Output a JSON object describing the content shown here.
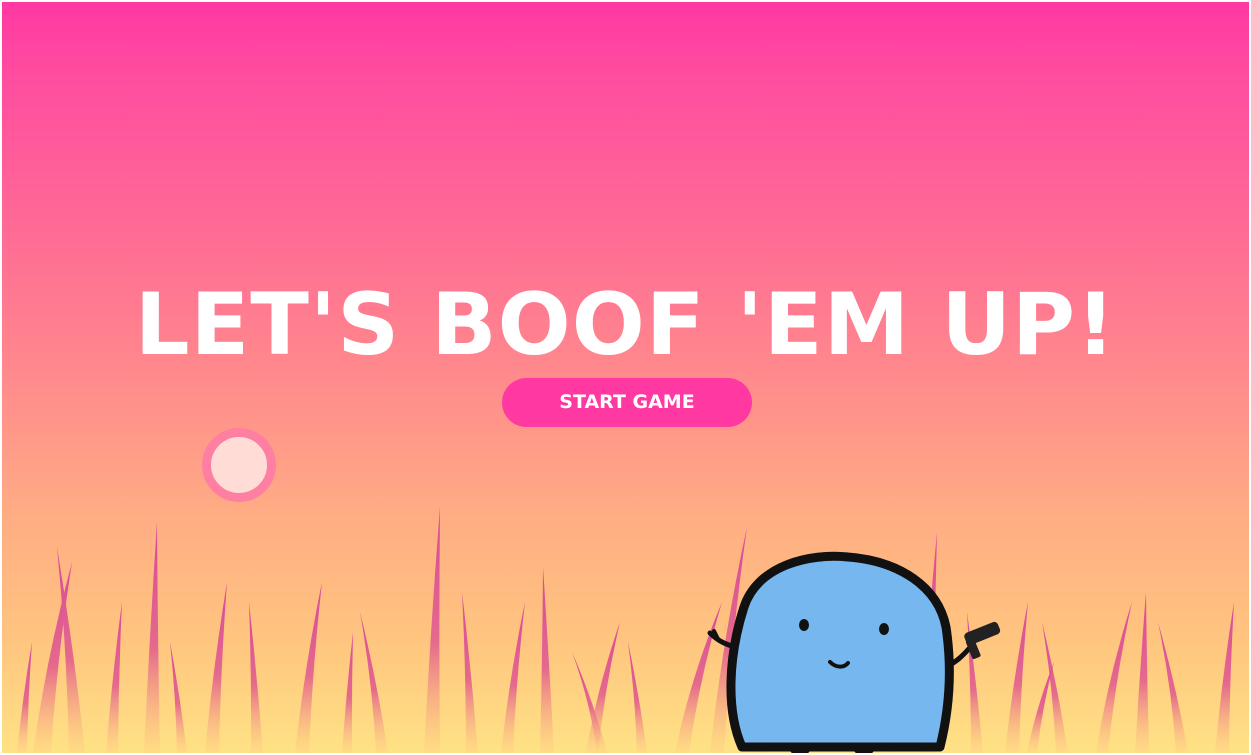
{
  "title": "LET'S BOOF 'EM UP!",
  "start_button": {
    "label": "START GAME"
  },
  "colors": {
    "sky_top": "#ff38a2",
    "sky_bottom": "#ffe285",
    "button": "#ff38a2",
    "grass": "#d9479a",
    "target_ring": "#ff7fa3",
    "target_fill": "#ffddd6",
    "character_body": "#77b7f0"
  },
  "icons": {
    "target": "target-icon",
    "character": "blob-character-icon",
    "held_item": "dart-gun-icon"
  }
}
